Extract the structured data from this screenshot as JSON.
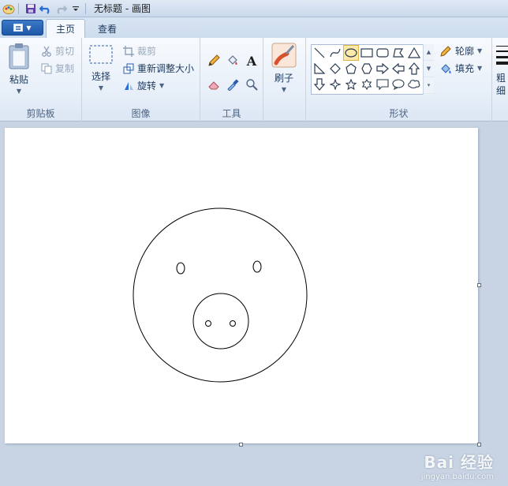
{
  "window": {
    "title": "无标题 - 画图"
  },
  "tabs": {
    "home": "主页",
    "view": "查看"
  },
  "clipboard": {
    "paste": "粘贴",
    "cut": "剪切",
    "copy": "复制",
    "group": "剪贴板"
  },
  "image": {
    "select": "选择",
    "crop": "裁剪",
    "resize": "重新调整大小",
    "rotate": "旋转",
    "group": "图像"
  },
  "tools": {
    "text_glyph": "A",
    "group": "工具"
  },
  "brushes": {
    "label": "刷子"
  },
  "shapes": {
    "outline": "轮廓",
    "fill": "填充",
    "group": "形状"
  },
  "size": {
    "label_partial": "粗细"
  },
  "watermark": {
    "main": "Bai 经验",
    "sub": "jingyan.baidu.com"
  },
  "colors": {
    "accent": "#1e58a8",
    "ribbon_bg": "#e9f0f9",
    "workspace": "#c8d4e3",
    "selected_shape": "#fde9a8"
  }
}
